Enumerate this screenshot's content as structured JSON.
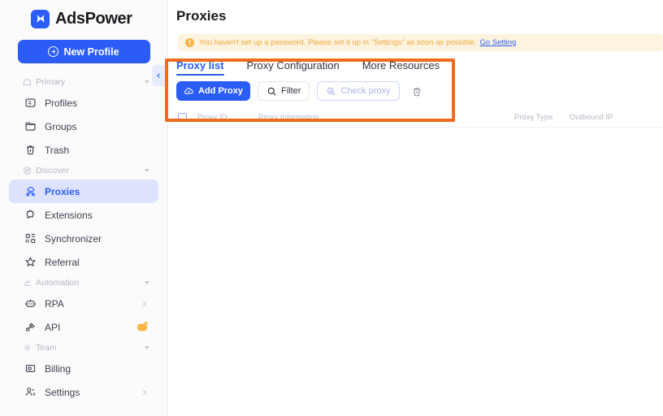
{
  "brand": {
    "name": "AdsPower",
    "logo_icon": "adspower-x-logo"
  },
  "sidebar": {
    "new_profile_label": "New Profile",
    "groups": [
      {
        "label": "Primary",
        "icon": "home-icon",
        "items": [
          {
            "label": "Profiles",
            "icon": "profiles-icon",
            "active": false,
            "chevron": false,
            "badge": false
          },
          {
            "label": "Groups",
            "icon": "folder-icon",
            "active": false,
            "chevron": false,
            "badge": false
          },
          {
            "label": "Trash",
            "icon": "trash-icon",
            "active": false,
            "chevron": false,
            "badge": false
          }
        ]
      },
      {
        "label": "Discover",
        "icon": "compass-icon",
        "items": [
          {
            "label": "Proxies",
            "icon": "proxies-icon",
            "active": true,
            "chevron": false,
            "badge": false
          },
          {
            "label": "Extensions",
            "icon": "extensions-icon",
            "active": false,
            "chevron": false,
            "badge": false
          },
          {
            "label": "Synchronizer",
            "icon": "synchronizer-icon",
            "active": false,
            "chevron": false,
            "badge": false
          },
          {
            "label": "Referral",
            "icon": "star-icon",
            "active": false,
            "chevron": false,
            "badge": false
          }
        ]
      },
      {
        "label": "Automation",
        "icon": "automation-icon",
        "items": [
          {
            "label": "RPA",
            "icon": "robot-icon",
            "active": false,
            "chevron": true,
            "badge": false
          },
          {
            "label": "API",
            "icon": "api-icon",
            "active": false,
            "chevron": false,
            "badge": true
          }
        ]
      },
      {
        "label": "Team",
        "icon": "gear-icon",
        "items": [
          {
            "label": "Billing",
            "icon": "billing-icon",
            "active": false,
            "chevron": false,
            "badge": false
          },
          {
            "label": "Settings",
            "icon": "people-icon",
            "active": false,
            "chevron": true,
            "badge": false
          }
        ]
      }
    ],
    "collapse_icon": "chevron-left-icon"
  },
  "main": {
    "page_title": "Proxies",
    "warning": {
      "icon": "exclamation-circle-icon",
      "text": "You haven't set up a password. Please set it up in \"Settings\" as soon as possible.",
      "link_label": "Go Setting"
    },
    "tabs": [
      {
        "label": "Proxy list",
        "active": true
      },
      {
        "label": "Proxy Configuration",
        "active": false
      },
      {
        "label": "More Resources",
        "active": false
      }
    ],
    "toolbar": {
      "add_proxy_label": "Add Proxy",
      "add_proxy_icon": "cloud-add-icon",
      "filter_label": "Filter",
      "filter_icon": "search-icon",
      "check_proxy_label": "Check proxy",
      "check_proxy_icon": "search-check-icon",
      "delete_icon": "trash-icon"
    },
    "table": {
      "columns": [
        "Proxy ID",
        "Proxy Information",
        "Proxy Type",
        "Outbound IP"
      ],
      "rows": []
    }
  },
  "annotation": {
    "color": "#ef6c1f"
  },
  "colors": {
    "accent": "#2b5cf6",
    "active_nav_bg": "#dde2fd",
    "warning_bg": "#fdf3df",
    "warning_text": "#f0a93c",
    "annotation": "#ef6c1f",
    "badge_orange": "#f8b546"
  }
}
